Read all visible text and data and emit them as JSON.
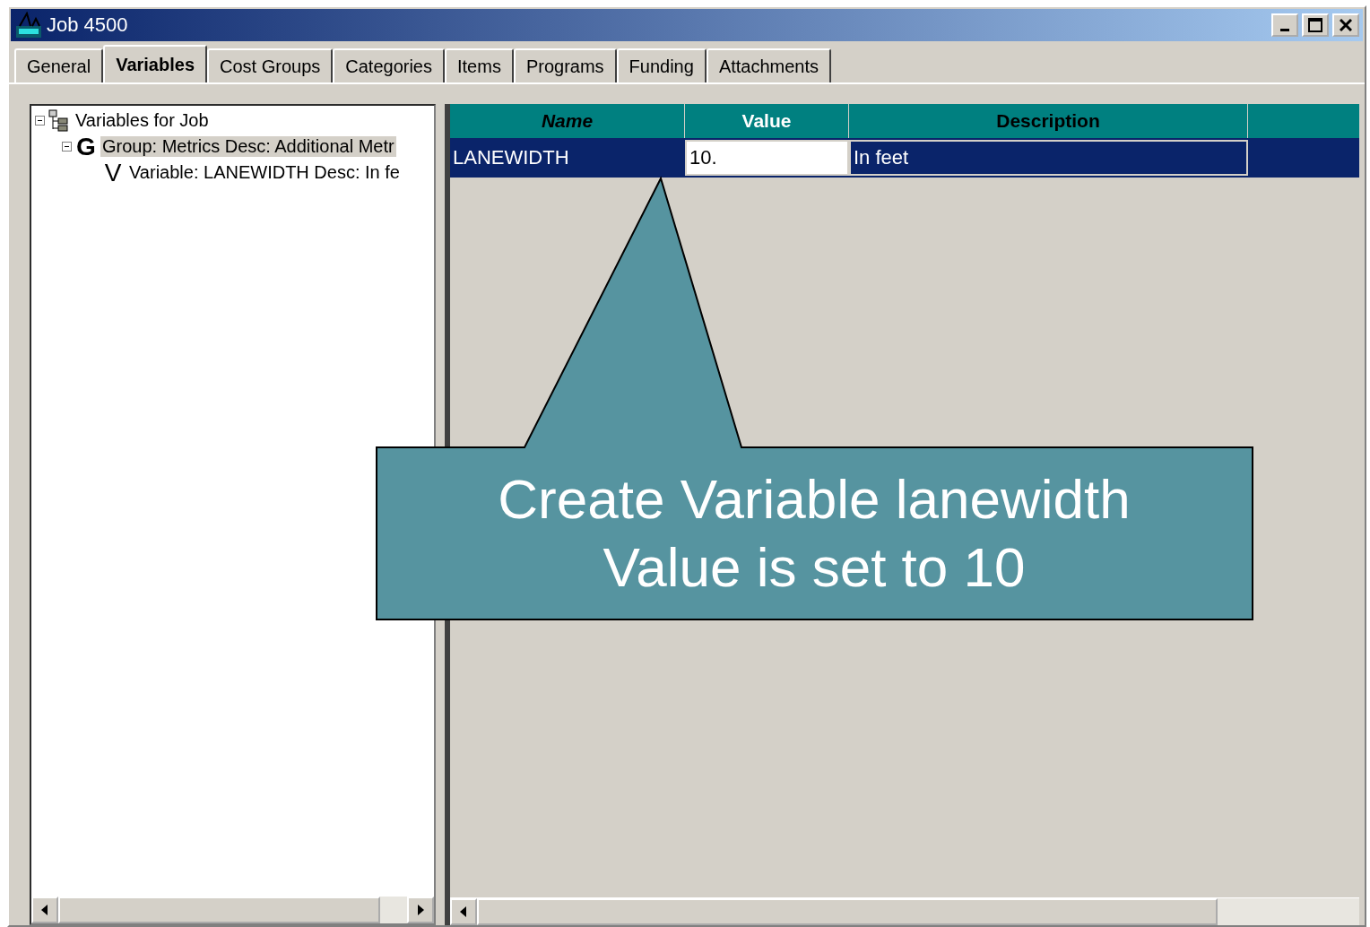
{
  "window": {
    "title": "Job 4500"
  },
  "tabs": [
    {
      "label": "General",
      "selected": false
    },
    {
      "label": "Variables",
      "selected": true
    },
    {
      "label": "Cost Groups",
      "selected": false
    },
    {
      "label": "Categories",
      "selected": false
    },
    {
      "label": "Items",
      "selected": false
    },
    {
      "label": "Programs",
      "selected": false
    },
    {
      "label": "Funding",
      "selected": false
    },
    {
      "label": "Attachments",
      "selected": false
    }
  ],
  "tree": [
    {
      "kind": "root",
      "label": "Variables for Job",
      "expanded": true,
      "selected": false,
      "children": [
        {
          "kind": "group",
          "glyph": "G",
          "label": "Group: Metrics  Desc: Additional Metr",
          "expanded": true,
          "selected": true,
          "children": [
            {
              "kind": "variable",
              "glyph": "V",
              "label": "Variable: LANEWIDTH  Desc: In fe",
              "selected": false
            }
          ]
        }
      ]
    }
  ],
  "table": {
    "columns": [
      "Name",
      "Value",
      "Description"
    ],
    "rows": [
      {
        "selected": true,
        "cells": [
          {
            "text": "LANEWIDTH",
            "editing": false
          },
          {
            "text": "10.",
            "editing": true
          },
          {
            "text": "In feet",
            "editing": false
          }
        ]
      }
    ]
  },
  "callout": {
    "lines": [
      "Create Variable lanewidth",
      "Value is set to 10"
    ]
  }
}
